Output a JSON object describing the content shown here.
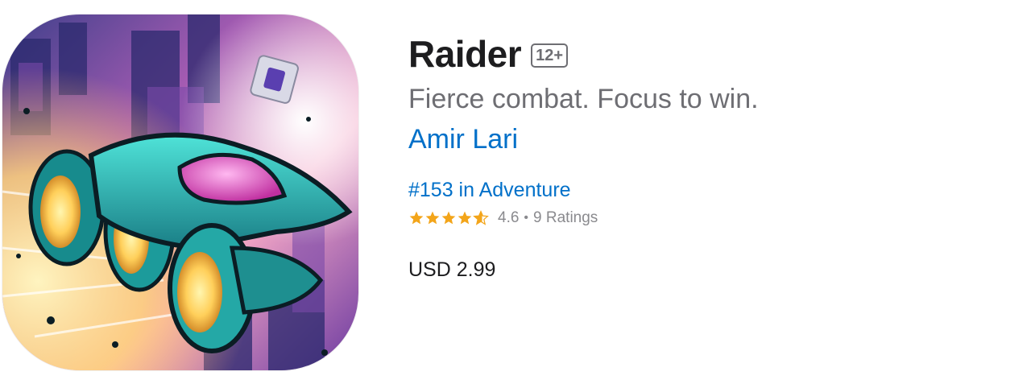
{
  "app": {
    "name": "Raider",
    "age_rating": "12+",
    "subtitle": "Fierce combat. Focus to win.",
    "developer": "Amir Lari",
    "rank": "#153 in Adventure",
    "rating": {
      "value": "4.6",
      "separator": "•",
      "count": "9 Ratings",
      "stars_out_of_5": 4.6
    },
    "price": "USD 2.99",
    "icon": "app-icon-spaceship-artwork"
  },
  "colors": {
    "link": "#0070c9",
    "star": "#f3a51a",
    "title": "#1d1d1f",
    "secondary": "#6e6e73"
  }
}
